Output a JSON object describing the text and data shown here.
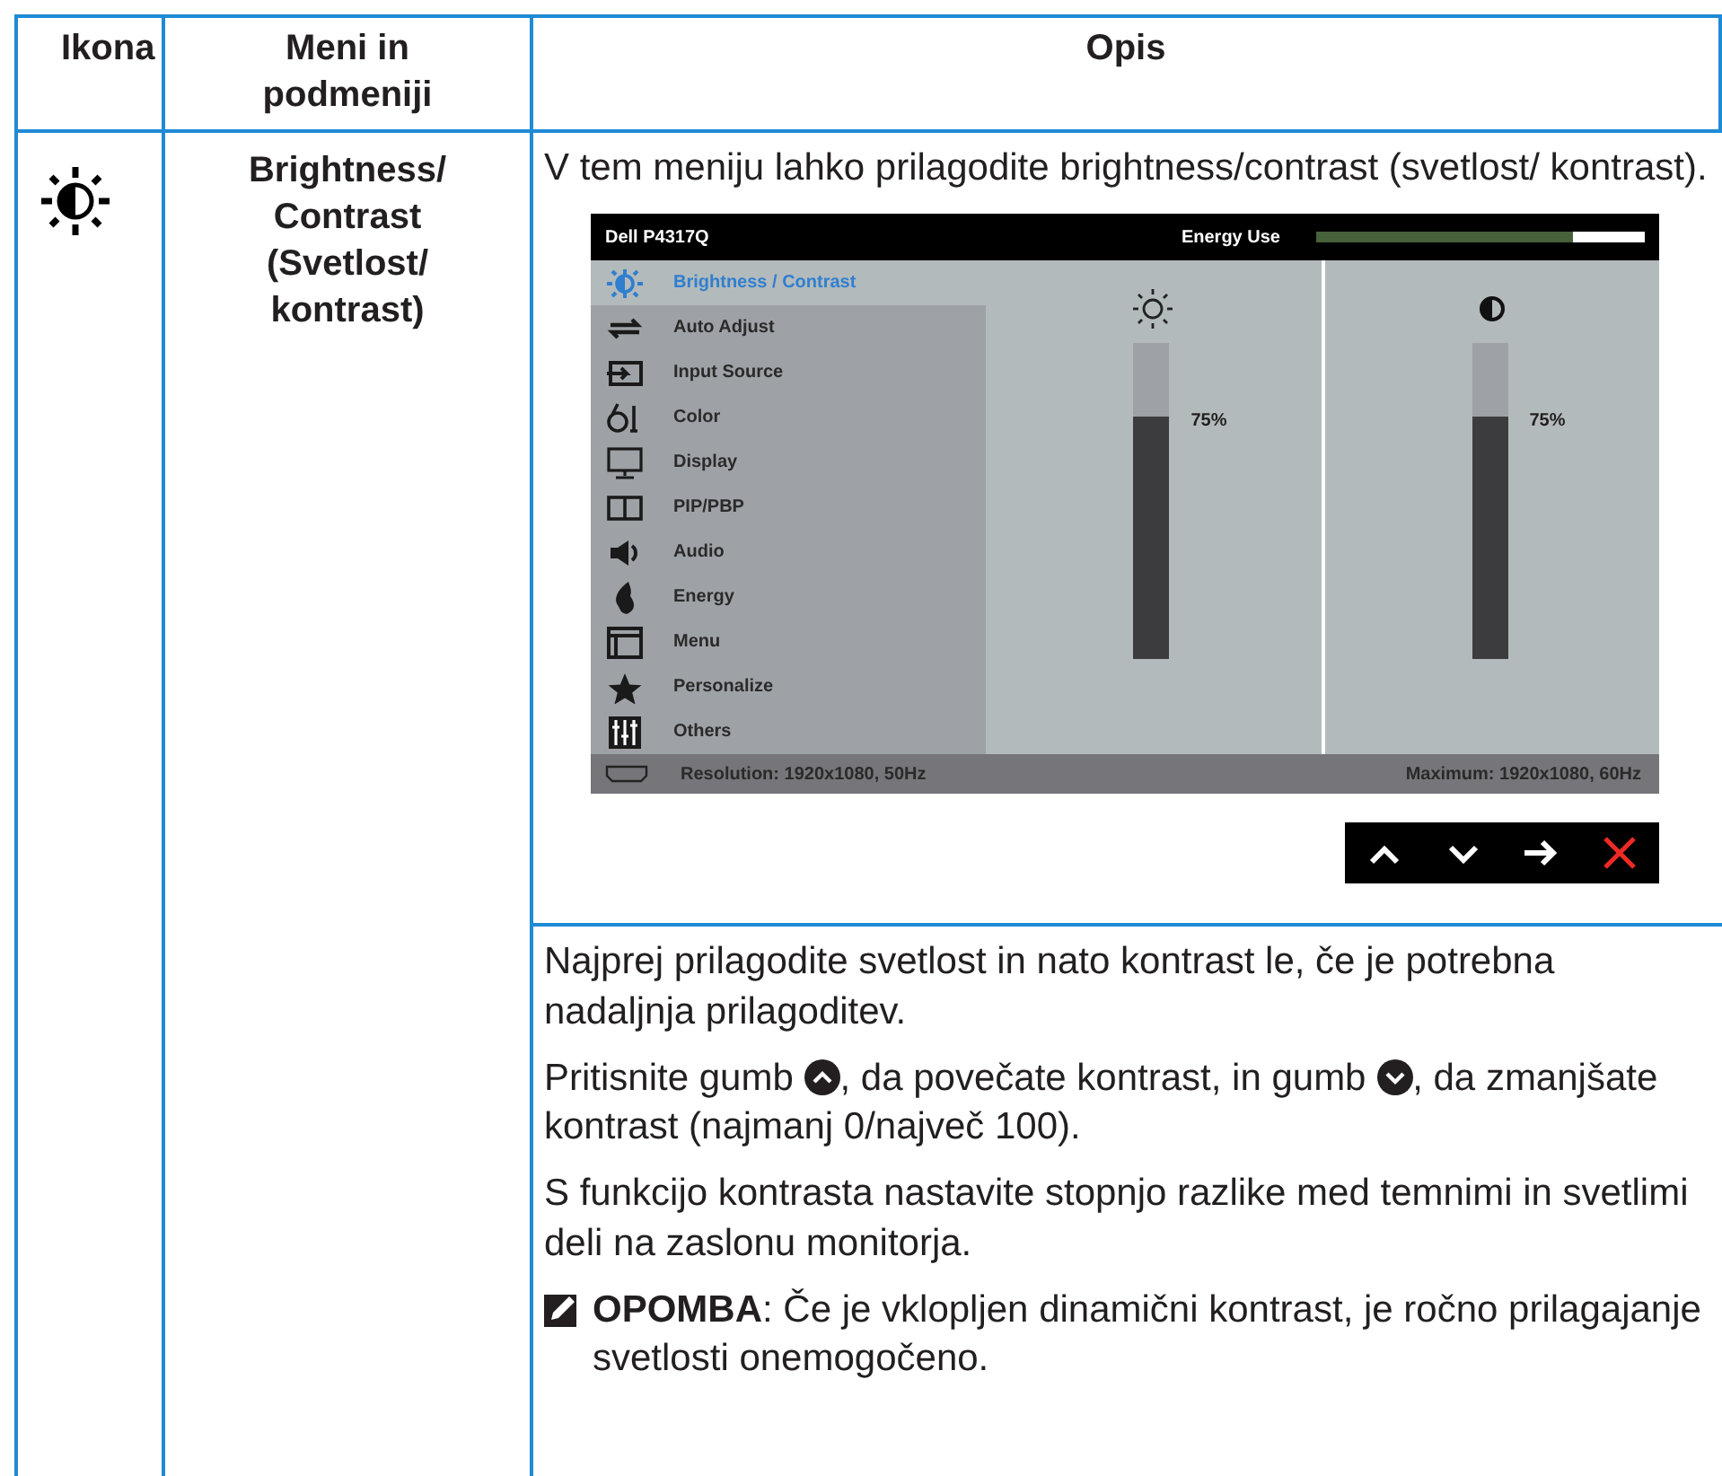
{
  "table": {
    "columns": [
      "Ikona",
      "Meni in podmeniji",
      "Opis"
    ],
    "row": {
      "menu_label": "Brightness/ Contrast (Svetlost/ kontrast)",
      "intro": "V tem meniju lahko prilagodite brightness/contrast (svetlost/ kontrast).",
      "osd": {
        "model": "Dell P4317Q",
        "energy": {
          "label": "Energy Use",
          "level": 0.78
        },
        "items": [
          {
            "label": "Brightness / Contrast",
            "selected": true
          },
          {
            "label": "Auto Adjust",
            "selected": false
          },
          {
            "label": "Input Source",
            "selected": false
          },
          {
            "label": "Color",
            "selected": false
          },
          {
            "label": "Display",
            "selected": false
          },
          {
            "label": "PIP/PBP",
            "selected": false
          },
          {
            "label": "Audio",
            "selected": false
          },
          {
            "label": "Energy",
            "selected": false
          },
          {
            "label": "Menu",
            "selected": false
          },
          {
            "label": "Personalize",
            "selected": false
          },
          {
            "label": "Others",
            "selected": false
          }
        ],
        "sliders": [
          {
            "kind": "brightness",
            "level": 0.77,
            "reading": "75%"
          },
          {
            "kind": "contrast",
            "level": 0.77,
            "reading": "75%"
          }
        ],
        "status_left": "Resolution: 1920x1080, 50Hz",
        "status_right": "Maximum: 1920x1080, 60Hz",
        "nav_buttons": [
          {
            "kind": "up"
          },
          {
            "kind": "down"
          },
          {
            "kind": "enter"
          },
          {
            "kind": "exit"
          }
        ]
      },
      "paragraphs": [
        {
          "parts": [
            {
              "kind": "text",
              "text": "Najprej prilagodite svetlost in nato kontrast le, če je potrebna nadaljnja prilagoditev."
            }
          ]
        },
        {
          "parts": [
            {
              "kind": "text",
              "text": "Pritisnite gumb "
            },
            {
              "kind": "up"
            },
            {
              "kind": "text",
              "text": ", da povečate kontrast, in gumb "
            },
            {
              "kind": "down"
            },
            {
              "kind": "text",
              "text": ", da zmanjšate kontrast (najmanj 0/največ 100)."
            }
          ]
        },
        {
          "parts": [
            {
              "kind": "text",
              "text": "S funkcijo kontrasta nastavite stopnjo razlike med temnimi in svetlimi deli na zaslonu monitorja."
            }
          ]
        }
      ],
      "note": "**OPOMBA**: Če je vklopljen dinamični kontrast, je ročno prilagajanje svetlosti onemogočeno."
    }
  }
}
